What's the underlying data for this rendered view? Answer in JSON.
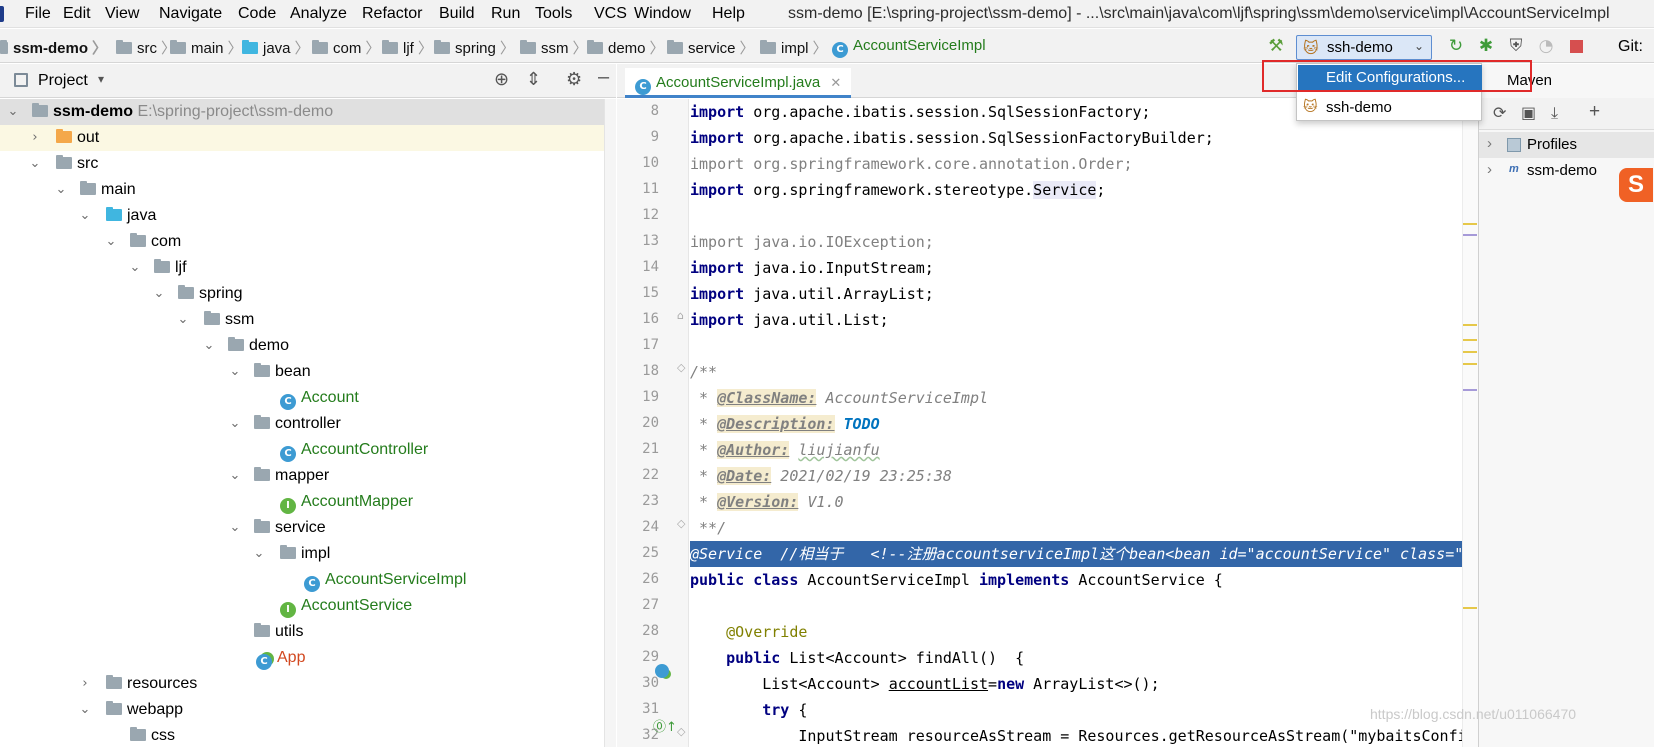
{
  "menu": [
    "File",
    "Edit",
    "View",
    "Navigate",
    "Code",
    "Analyze",
    "Refactor",
    "Build",
    "Run",
    "Tools",
    "VCS",
    "Window",
    "Help"
  ],
  "window_title": "ssm-demo [E:\\spring-project\\ssm-demo] - ...\\src\\main\\java\\com\\ljf\\spring\\ssm\\demo\\service\\impl\\AccountServiceImpl",
  "breadcrumbs": [
    "ssm-demo",
    "src",
    "main",
    "java",
    "com",
    "ljf",
    "spring",
    "ssm",
    "demo",
    "service",
    "impl",
    "AccountServiceImpl"
  ],
  "run_config": {
    "selected": "ssh-demo",
    "git_label": "Git:"
  },
  "dropdown": {
    "edit": "Edit Configurations...",
    "item": "ssh-demo"
  },
  "project_panel": {
    "title": "Project"
  },
  "tree": [
    {
      "label": "ssm-demo",
      "extra": "E:\\spring-project\\ssm-demo"
    },
    {
      "label": "out"
    },
    {
      "label": "src"
    },
    {
      "label": "main"
    },
    {
      "label": "java"
    },
    {
      "label": "com"
    },
    {
      "label": "ljf"
    },
    {
      "label": "spring"
    },
    {
      "label": "ssm"
    },
    {
      "label": "demo"
    },
    {
      "label": "bean"
    },
    {
      "label": "Account"
    },
    {
      "label": "controller"
    },
    {
      "label": "AccountController"
    },
    {
      "label": "mapper"
    },
    {
      "label": "AccountMapper"
    },
    {
      "label": "service"
    },
    {
      "label": "impl"
    },
    {
      "label": "AccountServiceImpl"
    },
    {
      "label": "AccountService"
    },
    {
      "label": "utils"
    },
    {
      "label": "App"
    },
    {
      "label": "resources"
    },
    {
      "label": "webapp"
    },
    {
      "label": "css"
    }
  ],
  "editor_tab": "AccountServiceImpl.java",
  "line_numbers": [
    "8",
    "9",
    "10",
    "11",
    "12",
    "13",
    "14",
    "15",
    "16",
    "17",
    "18",
    "19",
    "20",
    "21",
    "22",
    "23",
    "24",
    "25",
    "26",
    "27",
    "28",
    "29",
    "30",
    "31",
    "32"
  ],
  "code": {
    "imp": "import",
    "l8": " org.apache.ibatis.session.SqlSessionFactory;",
    "l9": " org.apache.ibatis.session.SqlSessionFactoryBuilder;",
    "l10": " org.springframework.core.annotation.Order;",
    "l11a": " org.springframework.stereotype.",
    "l11b": "Service",
    "l11c": ";",
    "l13": " java.io.IOException;",
    "l14": " java.io.InputStream;",
    "l15": " java.util.ArrayList;",
    "l16": " java.util.List;",
    "l18": "/**",
    "star": " * ",
    "t_classname": "@ClassName:",
    "v_classname": " AccountServiceImpl",
    "t_desc": "@Description:",
    "v_desc": "TODO",
    "t_author": "@Author:",
    "v_author": "liujianfu",
    "t_date": "@Date:",
    "v_date": " 2021/02/19 23:25:38",
    "t_version": "@Version:",
    "v_version": " V1.0",
    "l24": " **/",
    "l25": "@Service  //相当于   <!--注册accountserviceImpl这个bean<bean id=\"accountService\" class=\"",
    "l26a": "public",
    "l26b": "class",
    "l26c": " AccountServiceImpl ",
    "l26d": "implements",
    "l26e": " AccountService {",
    "l28": "@Override",
    "l29a": "public",
    "l29b": " List<Account> findAll()  {",
    "l30a": "List<Account> ",
    "l30b": "accountList",
    "l30c": "=",
    "l30d": "new",
    "l30e": " ArrayList<>();",
    "l31a": "try",
    "l31b": " {",
    "l32": "InputStream resourceAsStream = Resources.getResourceAsStream(\"mybaitsConfig"
  },
  "maven": {
    "title": "Maven",
    "profiles": "Profiles",
    "project": "ssm-demo"
  },
  "watermark": "https://blog.csdn.net/u011066470",
  "colors": {
    "accent": "#2675bf",
    "highlight_box": "#e02a2a",
    "selection": "#3366a8"
  }
}
